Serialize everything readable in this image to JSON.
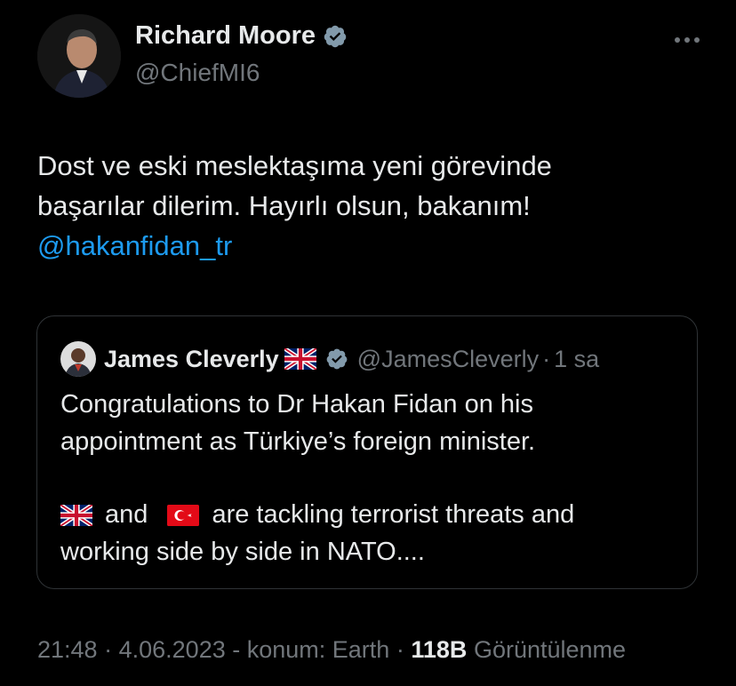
{
  "author": {
    "name": "Richard Moore",
    "handle": "@ChiefMI6",
    "verified": true,
    "avatar": "profile-photo"
  },
  "more_icon": "more-options-icon",
  "tweet": {
    "text_line1": "Dost ve eski meslektaşıma yeni görevinde",
    "text_line2": "başarılar dilerim.  Hayırlı olsun, bakanım!",
    "mention": "@hakanfidan_tr"
  },
  "quoted_tweet": {
    "name": "James Cleverly",
    "flag": "uk-flag-emoji",
    "verified": true,
    "handle": "@JamesCleverly",
    "separator": "·",
    "time": "1 sa",
    "text_line1": "Congratulations to Dr Hakan Fidan on his",
    "text_line2": "appointment as Türkiye’s foreign minister.",
    "text_line3_and": "and",
    "text_line3_rest": "are tackling terrorist threats and",
    "text_line4": "working side by side in NATO...."
  },
  "footer": {
    "time": "21:48",
    "sep1": "·",
    "date": "4.06.2023",
    "location": "- konum: Earth",
    "sep2": "·",
    "views_count": "118B",
    "views_label": "Görüntülenme"
  },
  "colors": {
    "background": "#000000",
    "text": "#e7e9ea",
    "secondary": "#71767b",
    "link": "#1d9bf0",
    "verified": "#829aab",
    "border": "#2f3336"
  }
}
